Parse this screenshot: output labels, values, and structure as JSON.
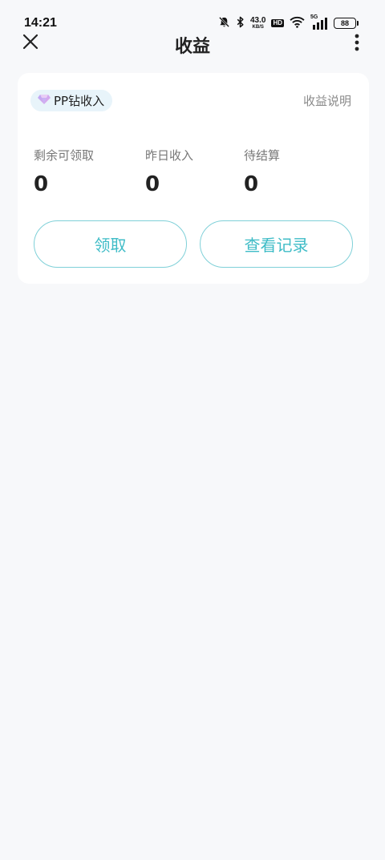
{
  "status_bar": {
    "time": "14:21",
    "net_speed_value": "43.0",
    "net_speed_unit": "KB/S",
    "hd_label": "HD",
    "signal_label": "5G",
    "battery": "88",
    "icons": [
      "mute-bell-icon",
      "bluetooth-icon",
      "wifi-icon",
      "signal-icon",
      "battery-icon"
    ]
  },
  "header": {
    "title": "收益",
    "close_icon": "close-icon",
    "more_icon": "more-vertical-icon"
  },
  "card": {
    "tag_label": "PP钻收入",
    "tag_icon": "diamond-icon",
    "explain_link": "收益说明",
    "stats": [
      {
        "label": "剩余可领取",
        "value": "0"
      },
      {
        "label": "昨日收入",
        "value": "0"
      },
      {
        "label": "待结算",
        "value": "0"
      }
    ],
    "claim_button": "领取",
    "records_button": "查看记录"
  },
  "colors": {
    "background": "#F7F8FA",
    "accent": "#3FBCC7",
    "accent_border": "#7FD0D8",
    "tag_bg": "#E8F4FA"
  }
}
